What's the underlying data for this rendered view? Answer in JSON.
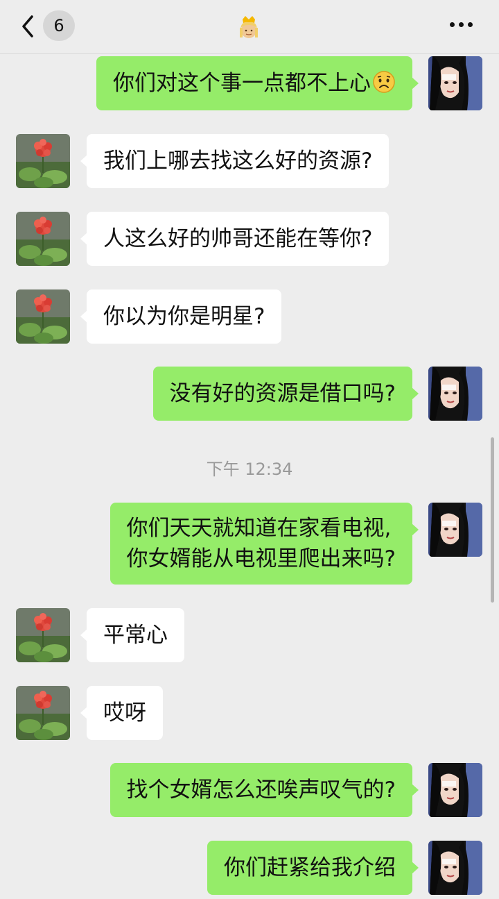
{
  "header": {
    "back_icon": "chevron-left-icon",
    "unread_count": "6",
    "title_icon": "princess-emoji-icon",
    "more_icon": "more-dots-icon"
  },
  "colors": {
    "background": "#ededed",
    "outgoing_bubble": "#95ec69",
    "incoming_bubble": "#ffffff"
  },
  "messages": [
    {
      "side": "out",
      "text": "你们对这个事一点都不上心",
      "emoji": "sad-face-emoji-icon"
    },
    {
      "side": "in",
      "text": "我们上哪去找这么好的资源?"
    },
    {
      "side": "in",
      "text": "人这么好的帅哥还能在等你?"
    },
    {
      "side": "in",
      "text": "你以为你是明星?"
    },
    {
      "side": "out",
      "text": "没有好的资源是借口吗?"
    },
    {
      "side": "out",
      "line1": "你们天天就知道在家看电视,",
      "line2": "你女婿能从电视里爬出来吗?"
    },
    {
      "side": "in",
      "text": "平常心"
    },
    {
      "side": "in",
      "text": "哎呀"
    },
    {
      "side": "out",
      "text": "找个女婿怎么还唉声叹气的?"
    },
    {
      "side": "out",
      "text": "你们赶紧给我介绍"
    }
  ],
  "timestamp": "下午 12:34",
  "avatars": {
    "incoming": "flower-avatar-icon",
    "outgoing": "girl-avatar-icon"
  }
}
